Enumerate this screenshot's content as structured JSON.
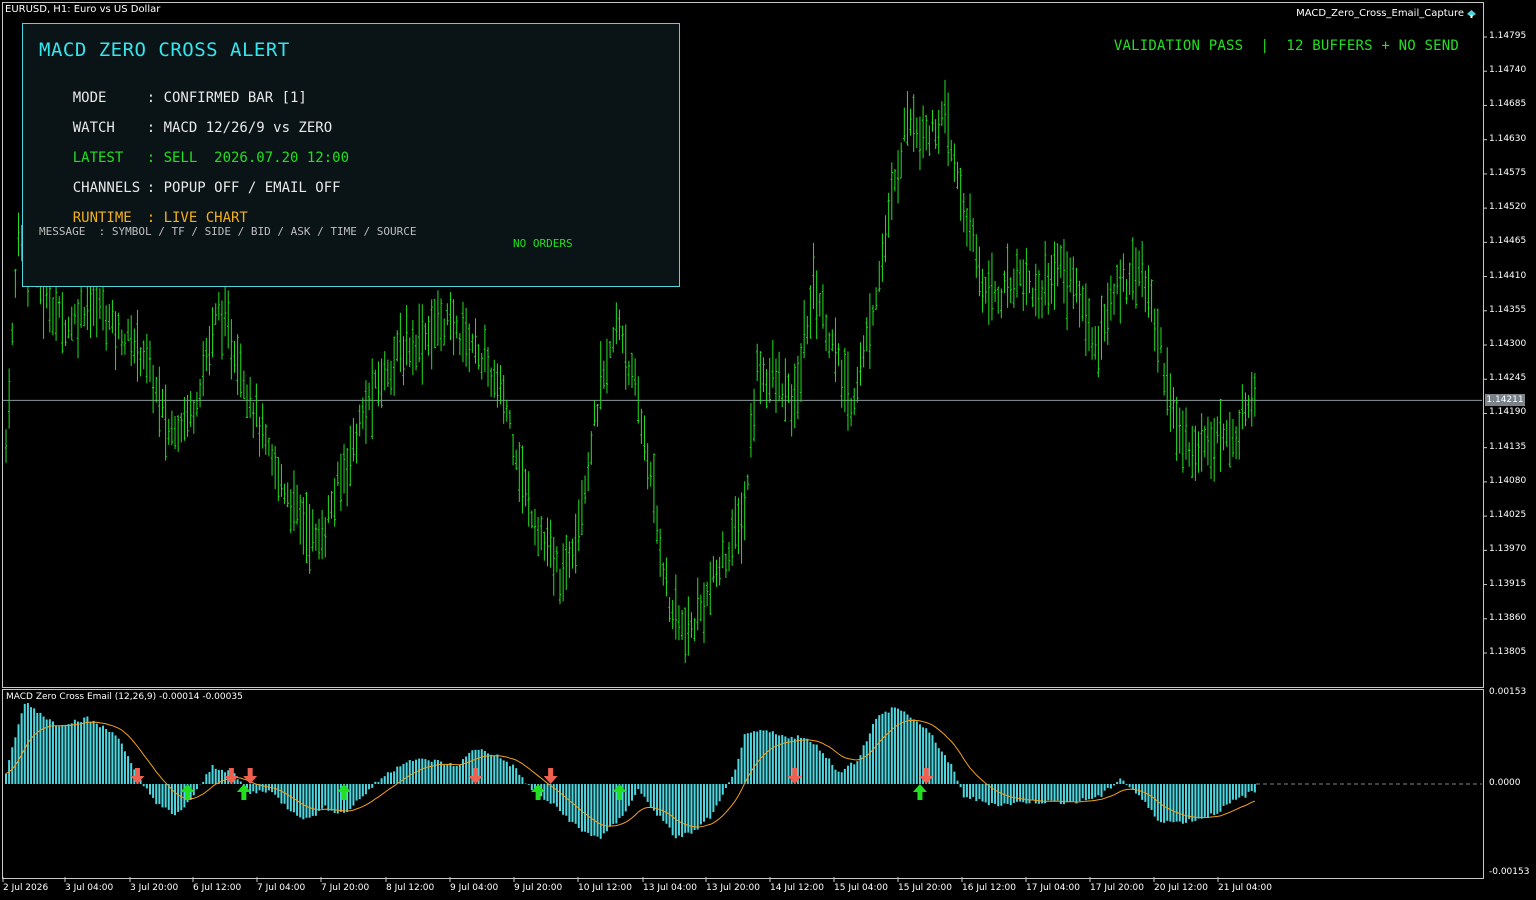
{
  "header": {
    "symbol_title": "EURUSD, H1:  Euro vs US Dollar",
    "ea_name": "MACD_Zero_Cross_Email_Capture"
  },
  "status_banner": "VALIDATION PASS  |  12 BUFFERS + NO SEND",
  "panel": {
    "title": "MACD ZERO CROSS ALERT",
    "rows": [
      {
        "key": "MODE",
        "value": ": CONFIRMED BAR [1]",
        "color": "#e8e8e8"
      },
      {
        "key": "WATCH",
        "value": ": MACD 12/26/9 vs ZERO",
        "color": "#e8e8e8"
      },
      {
        "key": "LATEST",
        "value": ": SELL  2026.07.20 12:00",
        "color": "#22e01f"
      },
      {
        "key": "CHANNELS",
        "value": ": POPUP OFF / EMAIL OFF",
        "color": "#e8e8e8"
      },
      {
        "key": "RUNTIME",
        "value": ": LIVE CHART",
        "color": "#f0b020"
      }
    ],
    "message": "MESSAGE  : SYMBOL / TF / SIDE / BID / ASK / TIME / SOURCE",
    "no_orders": "NO ORDERS"
  },
  "price_axis": [
    "1.14795",
    "1.14740",
    "1.14685",
    "1.14630",
    "1.14575",
    "1.14520",
    "1.14465",
    "1.14410",
    "1.14355",
    "1.14300",
    "1.14245",
    "1.14190",
    "1.14135",
    "1.14080",
    "1.14025",
    "1.13970",
    "1.13915",
    "1.13860",
    "1.13805"
  ],
  "current_price": "1.14211",
  "subwindow": {
    "title": "MACD Zero Cross Email (12,26,9) -0.00014 -0.00035",
    "axis": [
      "0.00153",
      "0.0000",
      "-0.00153"
    ]
  },
  "time_axis": [
    "2 Jul 2026",
    "3 Jul 04:00",
    "3 Jul 20:00",
    "6 Jul 12:00",
    "7 Jul 04:00",
    "7 Jul 20:00",
    "8 Jul 12:00",
    "9 Jul 04:00",
    "9 Jul 20:00",
    "10 Jul 12:00",
    "13 Jul 04:00",
    "13 Jul 20:00",
    "14 Jul 12:00",
    "15 Jul 04:00",
    "15 Jul 20:00",
    "16 Jul 12:00",
    "17 Jul 04:00",
    "17 Jul 20:00",
    "20 Jul 12:00",
    "21 Jul 04:00"
  ],
  "colors": {
    "candles": "#22e01f",
    "histogram": "#4dd7e0",
    "signal": "#f0a020",
    "buy_arrow": "#22e01f",
    "sell_arrow": "#f06050",
    "price_line": "#8a9aa0"
  },
  "price_series": {
    "anchors": [
      [
        0,
        1.1414
      ],
      [
        4,
        1.1448
      ],
      [
        12,
        1.1438
      ],
      [
        20,
        1.1433
      ],
      [
        28,
        1.1438
      ],
      [
        36,
        1.1432
      ],
      [
        44,
        1.1429
      ],
      [
        52,
        1.1416
      ],
      [
        60,
        1.142
      ],
      [
        68,
        1.1436
      ],
      [
        76,
        1.1425
      ],
      [
        84,
        1.1412
      ],
      [
        92,
        1.1404
      ],
      [
        100,
        1.1398
      ],
      [
        108,
        1.141
      ],
      [
        116,
        1.1421
      ],
      [
        124,
        1.1428
      ],
      [
        132,
        1.1431
      ],
      [
        140,
        1.1434
      ],
      [
        150,
        1.143
      ],
      [
        160,
        1.142
      ],
      [
        166,
        1.1406
      ],
      [
        172,
        1.1398
      ],
      [
        178,
        1.1392
      ],
      [
        184,
        1.1405
      ],
      [
        190,
        1.1423
      ],
      [
        196,
        1.1434
      ],
      [
        204,
        1.1415
      ],
      [
        212,
        1.1388
      ],
      [
        218,
        1.1383
      ],
      [
        224,
        1.139
      ],
      [
        230,
        1.1396
      ],
      [
        236,
        1.1403
      ],
      [
        240,
        1.1426
      ],
      [
        246,
        1.1424
      ],
      [
        252,
        1.142
      ],
      [
        258,
        1.144
      ],
      [
        264,
        1.143
      ],
      [
        270,
        1.142
      ],
      [
        276,
        1.1433
      ],
      [
        282,
        1.145
      ],
      [
        288,
        1.1467
      ],
      [
        294,
        1.1464
      ],
      [
        300,
        1.1466
      ],
      [
        306,
        1.1452
      ],
      [
        312,
        1.144
      ],
      [
        318,
        1.1438
      ],
      [
        324,
        1.1442
      ],
      [
        330,
        1.1438
      ],
      [
        336,
        1.1443
      ],
      [
        342,
        1.1439
      ],
      [
        348,
        1.143
      ],
      [
        356,
        1.144
      ],
      [
        362,
        1.1443
      ],
      [
        368,
        1.1432
      ],
      [
        374,
        1.1416
      ],
      [
        380,
        1.1413
      ],
      [
        386,
        1.1416
      ],
      [
        392,
        1.1414
      ],
      [
        398,
        1.1423
      ]
    ]
  },
  "macd_series": {
    "anchors": [
      [
        0,
        0.0002
      ],
      [
        6,
        0.00138
      ],
      [
        16,
        0.001
      ],
      [
        26,
        0.0011
      ],
      [
        36,
        0.0008
      ],
      [
        42,
        0.0001
      ],
      [
        48,
        -0.0003
      ],
      [
        54,
        -0.00055
      ],
      [
        60,
        -0.0002
      ],
      [
        66,
        0.0003
      ],
      [
        72,
        0.0002
      ],
      [
        78,
        -0.00015
      ],
      [
        84,
        -0.0001
      ],
      [
        90,
        -0.0004
      ],
      [
        96,
        -0.0006
      ],
      [
        102,
        -0.0004
      ],
      [
        108,
        -0.0005
      ],
      [
        114,
        -0.0002
      ],
      [
        120,
        0.0001
      ],
      [
        128,
        0.0004
      ],
      [
        136,
        0.0004
      ],
      [
        144,
        0.0003
      ],
      [
        150,
        0.0006
      ],
      [
        156,
        0.0005
      ],
      [
        162,
        0.0003
      ],
      [
        168,
        -0.0001
      ],
      [
        176,
        -0.0004
      ],
      [
        184,
        -0.0008
      ],
      [
        190,
        -0.0009
      ],
      [
        196,
        -0.0006
      ],
      [
        202,
        -0.0001
      ],
      [
        208,
        -0.0005
      ],
      [
        214,
        -0.0009
      ],
      [
        220,
        -0.0008
      ],
      [
        226,
        -0.0005
      ],
      [
        232,
        0.0001
      ],
      [
        236,
        0.0008
      ],
      [
        242,
        0.0009
      ],
      [
        248,
        0.0008
      ],
      [
        254,
        0.0008
      ],
      [
        260,
        0.0006
      ],
      [
        266,
        0.0002
      ],
      [
        272,
        0.0004
      ],
      [
        278,
        0.0011
      ],
      [
        284,
        0.0013
      ],
      [
        290,
        0.0011
      ],
      [
        296,
        0.0008
      ],
      [
        302,
        0.0003
      ],
      [
        306,
        -0.0002
      ],
      [
        312,
        -0.0003
      ],
      [
        318,
        -0.00035
      ],
      [
        326,
        -0.0003
      ],
      [
        334,
        -0.0003
      ],
      [
        342,
        -0.0003
      ],
      [
        350,
        -0.0002
      ],
      [
        356,
        0.0001
      ],
      [
        362,
        -0.0002
      ],
      [
        368,
        -0.0006
      ],
      [
        374,
        -0.00065
      ],
      [
        380,
        -0.0006
      ],
      [
        386,
        -0.0005
      ],
      [
        392,
        -0.0003
      ],
      [
        398,
        -0.00014
      ]
    ]
  },
  "signals": [
    {
      "bar": 42,
      "type": "sell"
    },
    {
      "bar": 58,
      "type": "buy"
    },
    {
      "bar": 72,
      "type": "sell"
    },
    {
      "bar": 76,
      "type": "buy"
    },
    {
      "bar": 78,
      "type": "sell"
    },
    {
      "bar": 108,
      "type": "buy"
    },
    {
      "bar": 150,
      "type": "sell"
    },
    {
      "bar": 170,
      "type": "buy"
    },
    {
      "bar": 174,
      "type": "sell"
    },
    {
      "bar": 196,
      "type": "buy"
    },
    {
      "bar": 252,
      "type": "sell"
    },
    {
      "bar": 292,
      "type": "buy"
    },
    {
      "bar": 294,
      "type": "sell"
    }
  ]
}
